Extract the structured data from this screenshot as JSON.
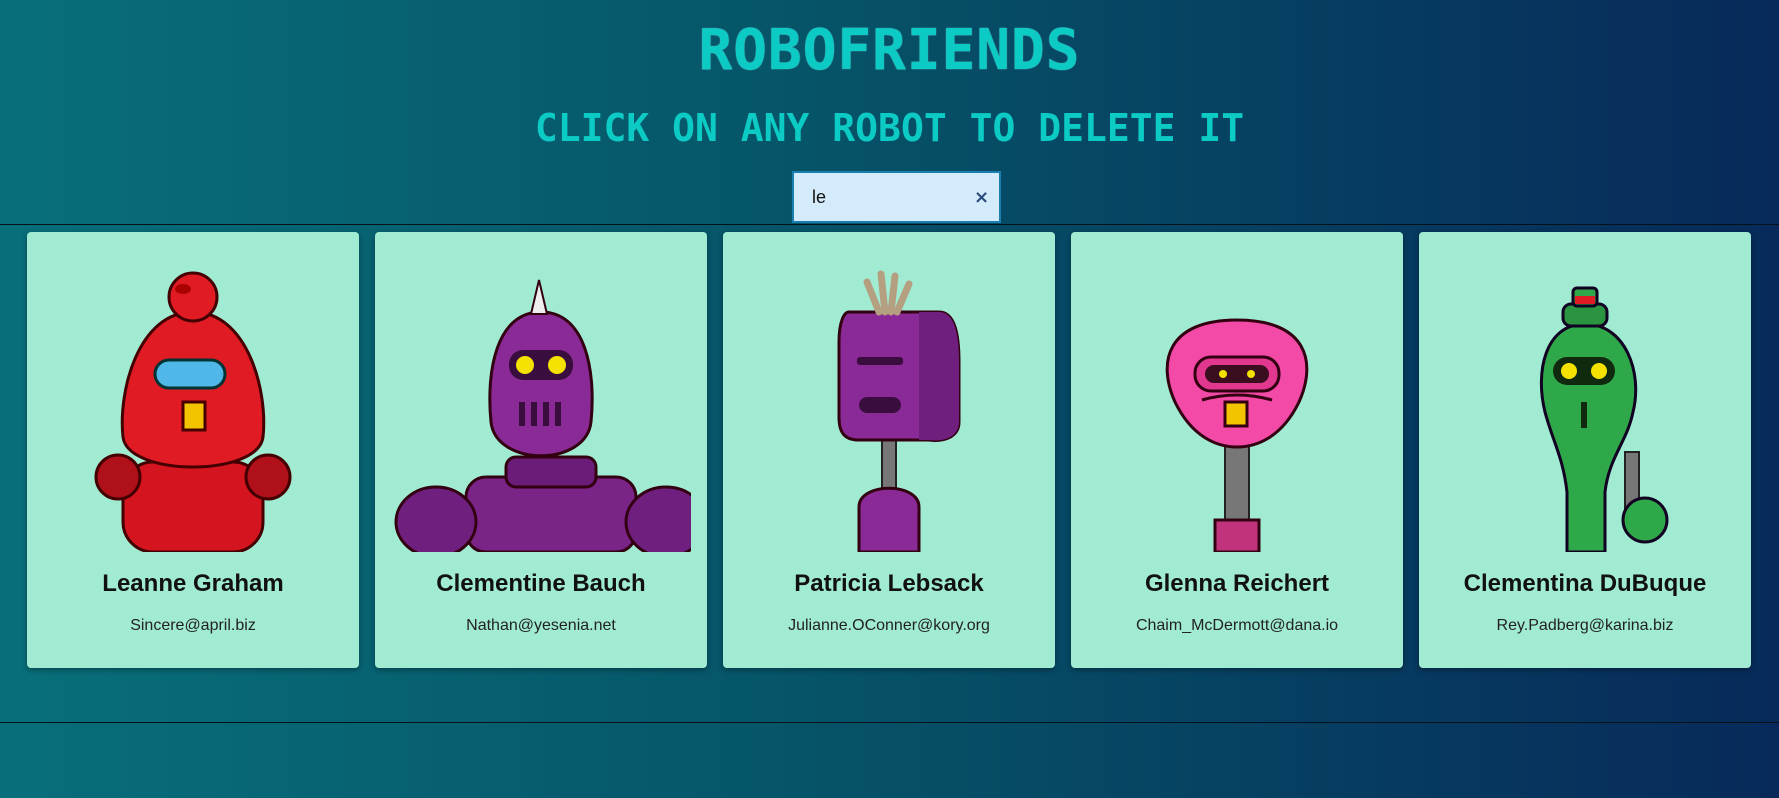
{
  "header": {
    "title": "ROBOFRIENDS",
    "subtitle": "CLICK ON ANY ROBOT TO DELETE IT"
  },
  "search": {
    "value": "le",
    "clear_icon": "close-icon",
    "clear_glyph": "×"
  },
  "robots": [
    {
      "name": "Leanne Graham",
      "email": "Sincere@april.biz",
      "color": "#e01b24"
    },
    {
      "name": "Clementine Bauch",
      "email": "Nathan@yesenia.net",
      "color": "#8a2a96"
    },
    {
      "name": "Patricia Lebsack",
      "email": "Julianne.OConner@kory.org",
      "color": "#8a2a96"
    },
    {
      "name": "Glenna Reichert",
      "email": "Chaim_McDermott@dana.io",
      "color": "#f24aa6"
    },
    {
      "name": "Clementina DuBuque",
      "email": "Rey.Padberg@karina.biz",
      "color": "#2fa84a"
    }
  ],
  "colors": {
    "title": "#0ccac4",
    "card_background": "#a0ebd2",
    "search_background": "#d4ebfb"
  }
}
